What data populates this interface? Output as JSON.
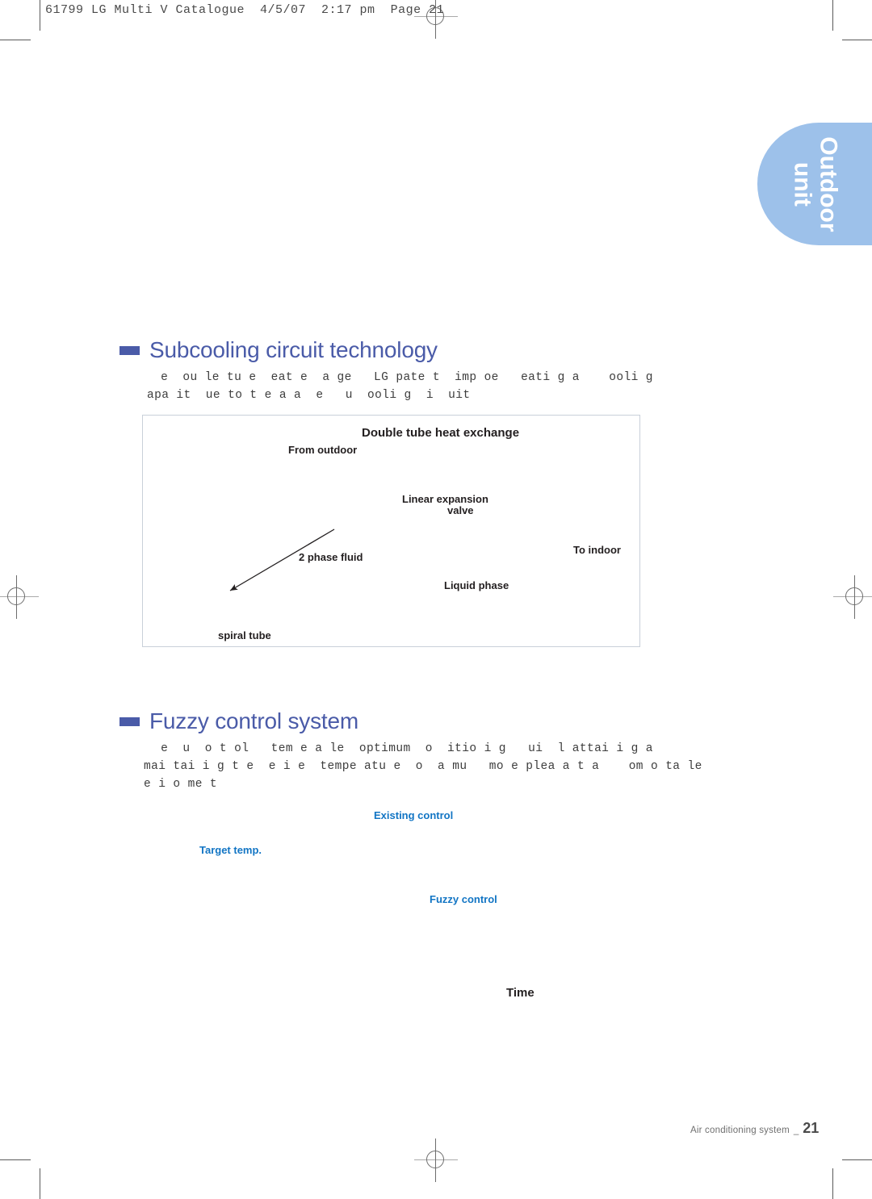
{
  "slug": "61799 LG Multi V Catalogue  4/5/07  2:17 pm  Page 21",
  "tab": {
    "line1": "Outdoor",
    "line2": "unit",
    "color": "#9dc1ea"
  },
  "sections": [
    {
      "heading": "Subcooling circuit technology",
      "body_line1": " e  ou le tu e  eat e  a ge   LG pate t  imp oe   eati g a    ooli g",
      "body_line2": "apa it  ue to t e a a  e   u  ooli g  i  uit"
    },
    {
      "heading": "Fuzzy control system",
      "body_line1": " e  u  o t ol   tem e a le  optimum  o  itio i g   ui  l attai i g a",
      "body_line2": "mai tai i g t e  e i e  tempe atu e  o  a mu   mo e plea a t a    om o ta le",
      "body_line3": "e i o me t"
    }
  ],
  "diagram": {
    "title": "Double tube heat exchange",
    "labels": [
      {
        "text": "From outdoor"
      },
      {
        "text": "Linear expansion"
      },
      {
        "text": "valve"
      },
      {
        "text": "To indoor"
      },
      {
        "text": "2 phase fluid"
      },
      {
        "text": "Liquid phase"
      },
      {
        "text": "spiral tube"
      }
    ],
    "border_color": "#c9d0d9"
  },
  "chart_data": {
    "type": "line",
    "title": "Fuzzy control system",
    "xlabel": "Time",
    "ylabel": "",
    "annotations": [
      {
        "text": "Existing control",
        "color": "#1275c4"
      },
      {
        "text": "Target temp.",
        "color": "#1275c4"
      },
      {
        "text": "Fuzzy control",
        "color": "#1275c4"
      },
      {
        "text": "Time",
        "color": "#231f20"
      }
    ],
    "series": [
      {
        "name": "Existing control",
        "values": []
      },
      {
        "name": "Fuzzy control",
        "values": []
      },
      {
        "name": "Target temp.",
        "values": []
      }
    ],
    "grid": false,
    "legend": "inline"
  },
  "footer": {
    "text": "Air conditioning system",
    "separator": "_",
    "page": "21"
  }
}
